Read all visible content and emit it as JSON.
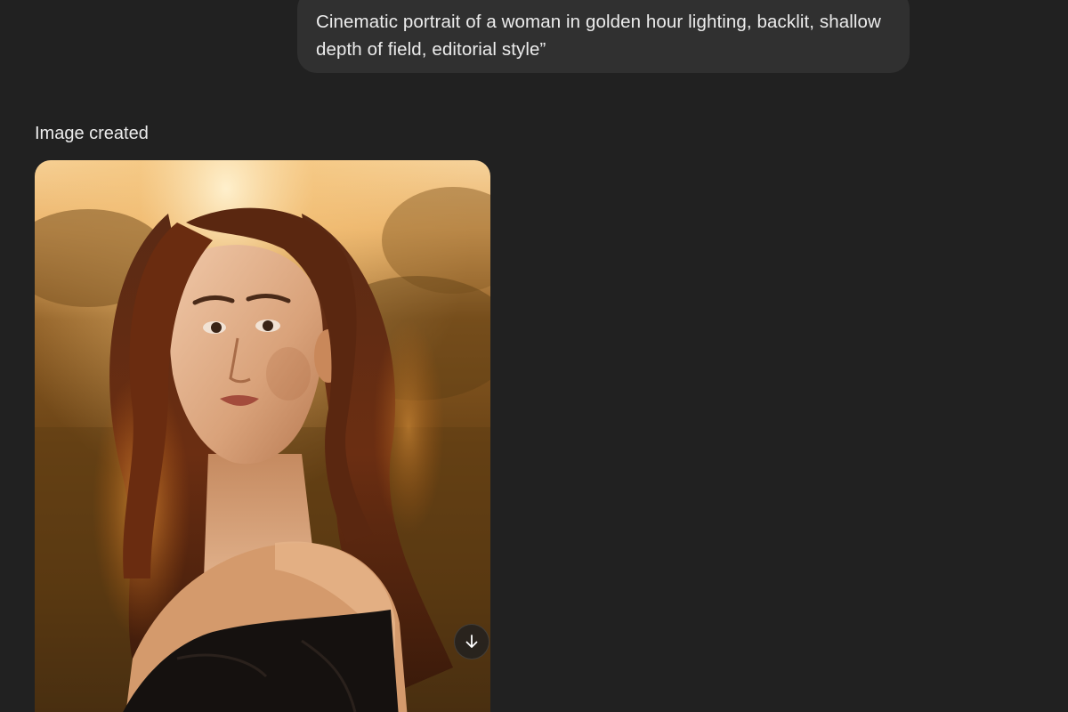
{
  "conversation": {
    "user_message": "Cinematic portrait of a woman in golden hour lighting, backlit, shallow depth of field, editorial style”",
    "response_status": "Image created"
  },
  "generated_image": {
    "subject": "portrait of a woman with long wavy auburn hair in an off-shoulder black top, backlit by golden sunset over a blurred field"
  },
  "icons": {
    "download": "arrow-down-icon"
  },
  "colors": {
    "background": "#212121",
    "bubble": "#303030",
    "text": "#ececec"
  }
}
